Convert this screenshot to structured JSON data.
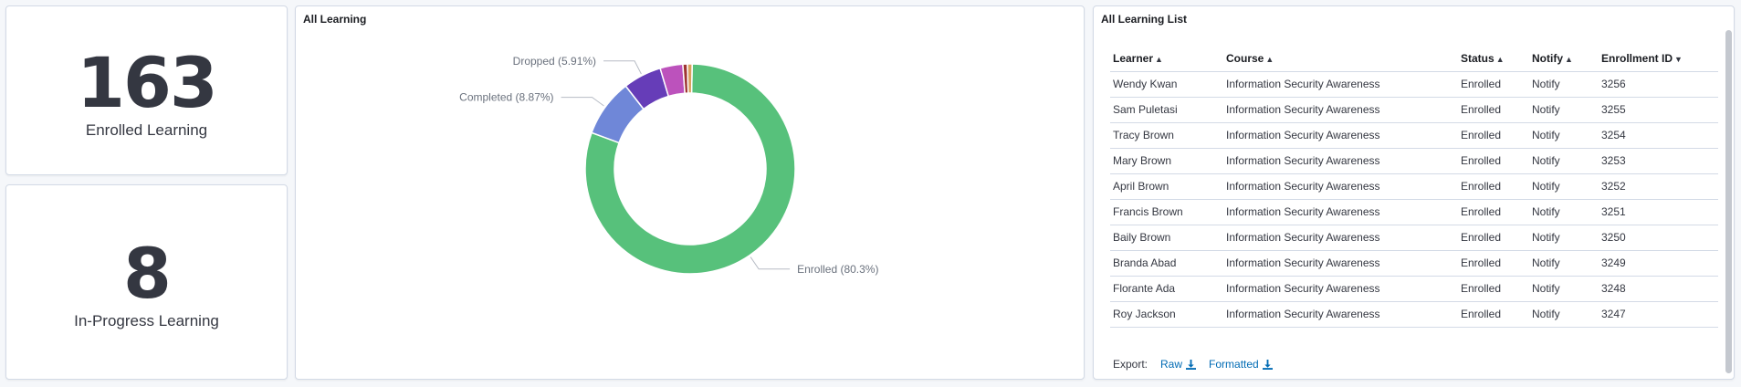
{
  "metrics": {
    "enrolled": {
      "value": "163",
      "label": "Enrolled Learning"
    },
    "in_progress": {
      "value": "8",
      "label": "In-Progress Learning"
    }
  },
  "chart_panel": {
    "title": "All Learning"
  },
  "chart_data": {
    "type": "pie",
    "donut": true,
    "title": "All Learning",
    "slices": [
      {
        "name": "Enrolled",
        "value": 80.3,
        "color": "#54b399",
        "fill": "#57c17b",
        "label": "Enrolled (80.3%)"
      },
      {
        "name": "Completed",
        "value": 8.87,
        "color": "#6f87d8",
        "label": "Completed (8.87%)"
      },
      {
        "name": "Dropped",
        "value": 5.91,
        "color": "#663db8",
        "label": "Dropped (5.91%)"
      },
      {
        "name": "",
        "value": 3.5,
        "color": "#bc52bc",
        "label": ""
      },
      {
        "name": "",
        "value": 0.7,
        "color": "#9e3533",
        "label": ""
      },
      {
        "name": "",
        "value": 0.72,
        "color": "#daa05d",
        "label": ""
      }
    ]
  },
  "list_panel": {
    "title": "All Learning List",
    "columns": [
      "Learner",
      "Course",
      "Status",
      "Notify",
      "Enrollment ID"
    ],
    "rows": [
      [
        "Wendy Kwan",
        "Information Security Awareness",
        "Enrolled",
        "Notify",
        "3256"
      ],
      [
        "Sam Puletasi",
        "Information Security Awareness",
        "Enrolled",
        "Notify",
        "3255"
      ],
      [
        "Tracy Brown",
        "Information Security Awareness",
        "Enrolled",
        "Notify",
        "3254"
      ],
      [
        "Mary Brown",
        "Information Security Awareness",
        "Enrolled",
        "Notify",
        "3253"
      ],
      [
        "April Brown",
        "Information Security Awareness",
        "Enrolled",
        "Notify",
        "3252"
      ],
      [
        "Francis Brown",
        "Information Security Awareness",
        "Enrolled",
        "Notify",
        "3251"
      ],
      [
        "Baily Brown",
        "Information Security Awareness",
        "Enrolled",
        "Notify",
        "3250"
      ],
      [
        "Branda Abad",
        "Information Security Awareness",
        "Enrolled",
        "Notify",
        "3249"
      ],
      [
        "Florante Ada",
        "Information Security Awareness",
        "Enrolled",
        "Notify",
        "3248"
      ],
      [
        "Roy Jackson",
        "Information Security Awareness",
        "Enrolled",
        "Notify",
        "3247"
      ]
    ],
    "export": {
      "label": "Export:",
      "raw": "Raw",
      "formatted": "Formatted"
    }
  },
  "colors": {
    "link": "#006bb4",
    "border": "#d3dae6",
    "text": "#343741"
  },
  "icons": {
    "sort": "sort-icon",
    "sort_desc": "sort-desc-icon",
    "download": "download-icon"
  }
}
